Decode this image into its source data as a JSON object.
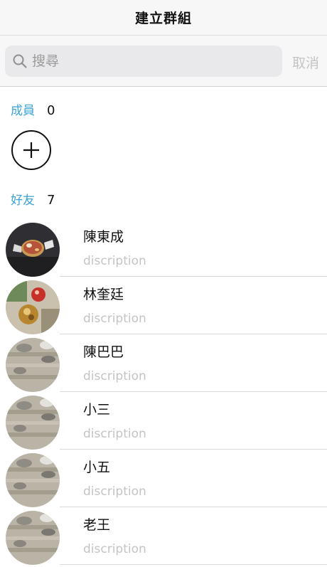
{
  "nav": {
    "title": "建立群組"
  },
  "search": {
    "placeholder": "搜尋",
    "value": "",
    "cancel_label": "取消"
  },
  "members": {
    "label": "成員",
    "count": "0"
  },
  "friends": {
    "label": "好友",
    "count": "7",
    "items": [
      {
        "name": "陳東成",
        "description": "discription",
        "avatar": "candy-dark"
      },
      {
        "name": "林奎廷",
        "description": "discription",
        "avatar": "candy-light"
      },
      {
        "name": "陳巴巴",
        "description": "discription",
        "avatar": "coins"
      },
      {
        "name": "小三",
        "description": "discription",
        "avatar": "coins"
      },
      {
        "name": "小五",
        "description": "discription",
        "avatar": "coins"
      },
      {
        "name": "老王",
        "description": "discription",
        "avatar": "coins"
      }
    ]
  },
  "colors": {
    "accent": "#3aa3d6",
    "muted": "#c4c4c4",
    "divider": "#d9d9d9"
  }
}
